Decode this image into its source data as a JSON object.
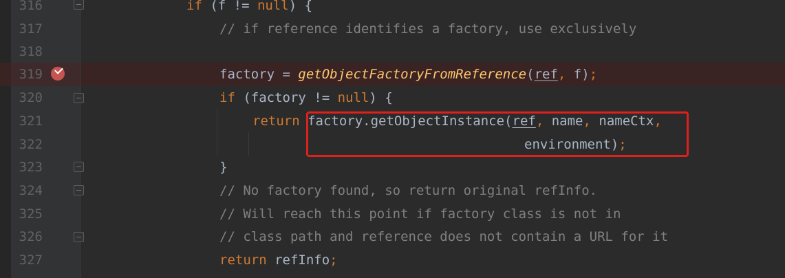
{
  "editor": {
    "lines": [
      {
        "number": "316",
        "tokens": [
          {
            "t": "if",
            "c": "kw"
          },
          {
            "t": " (f != ",
            "c": "pl"
          },
          {
            "t": "null",
            "c": "kw"
          },
          {
            "t": ") {",
            "c": "pl"
          }
        ]
      },
      {
        "number": "317",
        "tokens": [
          {
            "t": "// if reference identifies a factory, use exclusively",
            "c": "cm"
          }
        ]
      },
      {
        "number": "318",
        "tokens": []
      },
      {
        "number": "319",
        "tokens": [
          {
            "t": "factory = ",
            "c": "pl"
          },
          {
            "t": "getObjectFactoryFromReference",
            "c": "fn-it"
          },
          {
            "t": "(",
            "c": "pl"
          },
          {
            "t": "ref",
            "c": "pl ul"
          },
          {
            "t": ", ",
            "c": "kw"
          },
          {
            "t": "f)",
            "c": "pl"
          },
          {
            "t": ";",
            "c": "kw"
          }
        ]
      },
      {
        "number": "320",
        "tokens": [
          {
            "t": "if",
            "c": "kw"
          },
          {
            "t": " (factory != ",
            "c": "pl"
          },
          {
            "t": "null",
            "c": "kw"
          },
          {
            "t": ") {",
            "c": "pl"
          }
        ]
      },
      {
        "number": "321",
        "tokens": [
          {
            "t": "return ",
            "c": "kw"
          },
          {
            "t": "factory.getObjectInstance(",
            "c": "pl"
          },
          {
            "t": "ref",
            "c": "pl ul"
          },
          {
            "t": ", ",
            "c": "kw"
          },
          {
            "t": "name",
            "c": "pl"
          },
          {
            "t": ", ",
            "c": "kw"
          },
          {
            "t": "nameCtx",
            "c": "pl"
          },
          {
            "t": ",",
            "c": "kw"
          }
        ]
      },
      {
        "number": "322",
        "tokens": [
          {
            "t": "environment)",
            "c": "pl"
          },
          {
            "t": ";",
            "c": "kw"
          }
        ]
      },
      {
        "number": "323",
        "tokens": [
          {
            "t": "}",
            "c": "pl"
          }
        ]
      },
      {
        "number": "324",
        "tokens": [
          {
            "t": "// No factory found, so return original refInfo.",
            "c": "cm"
          }
        ]
      },
      {
        "number": "325",
        "tokens": [
          {
            "t": "// Will reach this point if factory class is not in",
            "c": "cm"
          }
        ]
      },
      {
        "number": "326",
        "tokens": [
          {
            "t": "// class path and reference does not contain a URL for it",
            "c": "cm"
          }
        ]
      },
      {
        "number": "327",
        "tokens": [
          {
            "t": "return ",
            "c": "kw"
          },
          {
            "t": "refInfo",
            "c": "pl"
          },
          {
            "t": ";",
            "c": "kw"
          }
        ]
      }
    ]
  },
  "colors": {
    "background": "#2b2b2b",
    "keyword": "#cc7832",
    "comment": "#808080",
    "method_italic": "#ffc66d",
    "plain": "#a9b7c6",
    "line_number": "#606366",
    "breakpoint": "#c75450",
    "highlight_box": "#e0201c"
  },
  "icons": {
    "breakpoint": "breakpoint-check-icon",
    "fold": "fold-marker-icon"
  }
}
